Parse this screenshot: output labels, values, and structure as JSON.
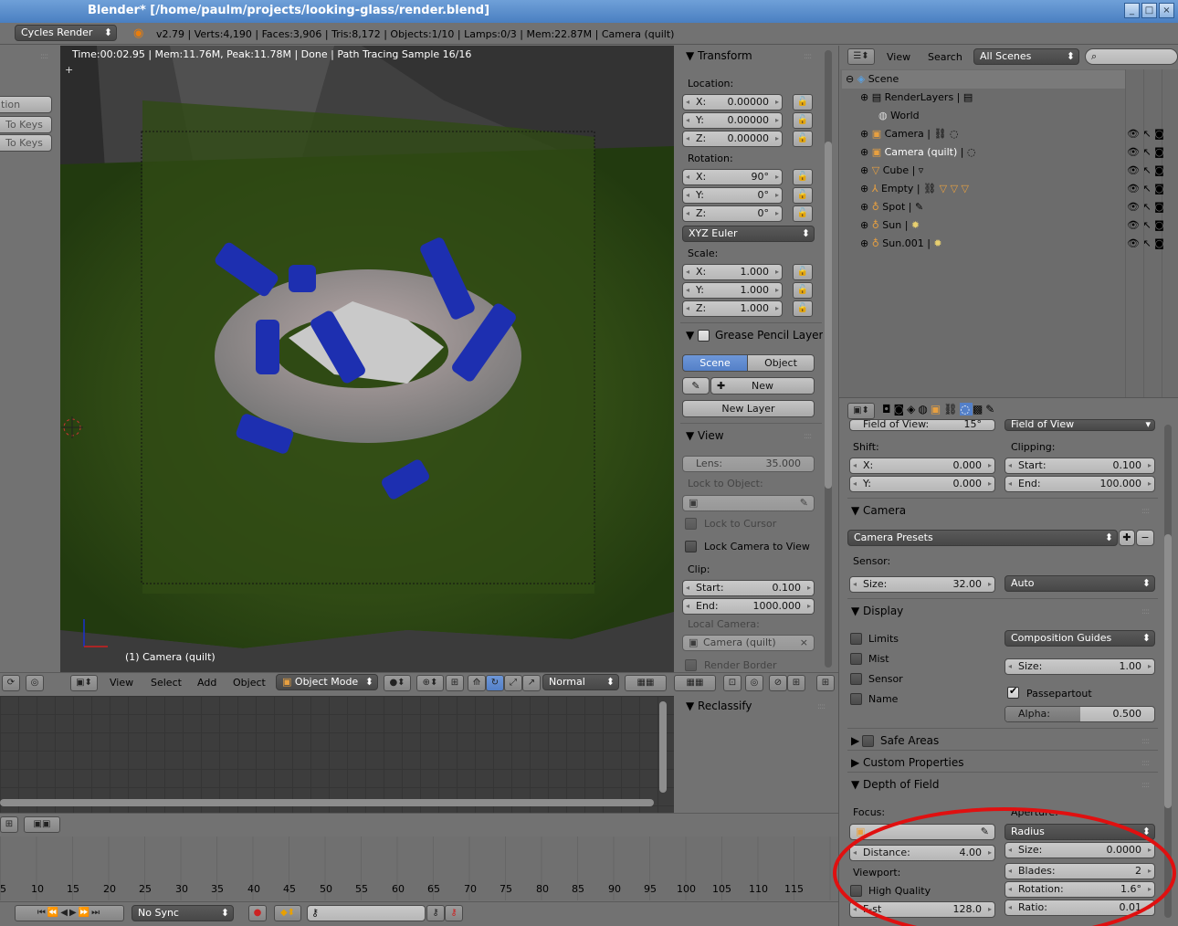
{
  "window": {
    "title": "Blender* [/home/paulm/projects/looking-glass/render.blend]",
    "minimize": "_",
    "maximize": "□",
    "close": "×"
  },
  "info": {
    "engine": "Cycles Render",
    "stats": "v2.79 | Verts:4,190 | Faces:3,906 | Tris:8,172 | Objects:1/10 | Lamps:0/3 | Mem:22.87M | Camera (quilt)"
  },
  "left_tools": {
    "item0": "tion",
    "item1": "To Keys",
    "item2": "To Keys"
  },
  "viewport": {
    "render_status": "Time:00:02.95 | Mem:11.76M, Peak:11.78M | Done | Path Tracing Sample 16/16",
    "object_label": "(1) Camera (quilt)"
  },
  "view_header": {
    "menus": [
      "View",
      "Select",
      "Add",
      "Object"
    ],
    "mode": "Object Mode",
    "shading": "Normal"
  },
  "transform": {
    "title": "Transform",
    "location_label": "Location:",
    "location": [
      {
        "axis": "X:",
        "value": "0.00000"
      },
      {
        "axis": "Y:",
        "value": "0.00000"
      },
      {
        "axis": "Z:",
        "value": "0.00000"
      }
    ],
    "rotation_label": "Rotation:",
    "rotation": [
      {
        "axis": "X:",
        "value": "90°"
      },
      {
        "axis": "Y:",
        "value": "0°"
      },
      {
        "axis": "Z:",
        "value": "0°"
      }
    ],
    "rotation_mode": "XYZ Euler",
    "scale_label": "Scale:",
    "scale": [
      {
        "axis": "X:",
        "value": "1.000"
      },
      {
        "axis": "Y:",
        "value": "1.000"
      },
      {
        "axis": "Z:",
        "value": "1.000"
      }
    ]
  },
  "grease": {
    "title": "Grease Pencil Layers",
    "tab_scene": "Scene",
    "tab_object": "Object",
    "new": "New",
    "new_layer": "New Layer"
  },
  "view_panel": {
    "title": "View",
    "lens_label": "Lens:",
    "lens": "35.000",
    "lock_obj": "Lock to Object:",
    "lock_cursor": "Lock to Cursor",
    "lock_cam": "Lock Camera to View",
    "clip": "Clip:",
    "clip_start_label": "Start:",
    "clip_start": "0.100",
    "clip_end_label": "End:",
    "clip_end": "1000.000",
    "local_cam": "Local Camera:",
    "local_cam_value": "Camera (quilt)",
    "render_border": "Render Border"
  },
  "reclassify": {
    "title": "Reclassify"
  },
  "outliner": {
    "menus": [
      "View",
      "Search"
    ],
    "scenes": "All Scenes",
    "items": [
      {
        "name": "Scene"
      },
      {
        "name": "RenderLayers"
      },
      {
        "name": "World"
      },
      {
        "name": "Camera"
      },
      {
        "name": "Camera (quilt)"
      },
      {
        "name": "Cube"
      },
      {
        "name": "Empty"
      },
      {
        "name": "Spot"
      },
      {
        "name": "Sun"
      },
      {
        "name": "Sun.001"
      }
    ]
  },
  "props": {
    "fov_label": "Field of View:",
    "fov": "15°",
    "fov_mode": "Field of View",
    "shift": "Shift:",
    "shift_x": "0.000",
    "shift_y": "0.000",
    "clipping": "Clipping:",
    "clip_start": "0.100",
    "clip_end": "100.000",
    "x": "X:",
    "y": "Y:",
    "start": "Start:",
    "end": "End:",
    "camera_title": "Camera",
    "camera_presets": "Camera Presets",
    "sensor": "Sensor:",
    "size_label": "Size:",
    "sensor_size": "32.00",
    "sensor_fit": "Auto",
    "display_title": "Display",
    "limits": "Limits",
    "mist": "Mist",
    "sensor_chk": "Sensor",
    "name_chk": "Name",
    "composition": "Composition Guides",
    "disp_size": "1.00",
    "passepartout": "Passepartout",
    "alpha_label": "Alpha:",
    "alpha": "0.500",
    "alpha_fraction": 0.5,
    "safe_areas": "Safe Areas",
    "custom_props": "Custom Properties",
    "dof_title": "Depth of Field",
    "focus": "Focus:",
    "aperture": "Aperture:",
    "distance_label": "Distance:",
    "distance": "4.00",
    "radius": "Radius",
    "ap_size": "0.0000",
    "blades_label": "Blades:",
    "blades": "2",
    "rotation_label": "Rotation:",
    "rotation": "1.6°",
    "viewport": "Viewport:",
    "high_quality": "High Quality",
    "fstop_label": "F-st",
    "fstop": "128.0",
    "ratio_label": "Ratio:",
    "ratio": "0.01"
  },
  "timeline": {
    "ticks": [
      "5",
      "10",
      "15",
      "20",
      "25",
      "30",
      "35",
      "40",
      "45",
      "50",
      "55",
      "60",
      "65",
      "70",
      "75",
      "80",
      "85",
      "90",
      "95",
      "100",
      "105",
      "110",
      "115"
    ],
    "sync": "No Sync"
  }
}
